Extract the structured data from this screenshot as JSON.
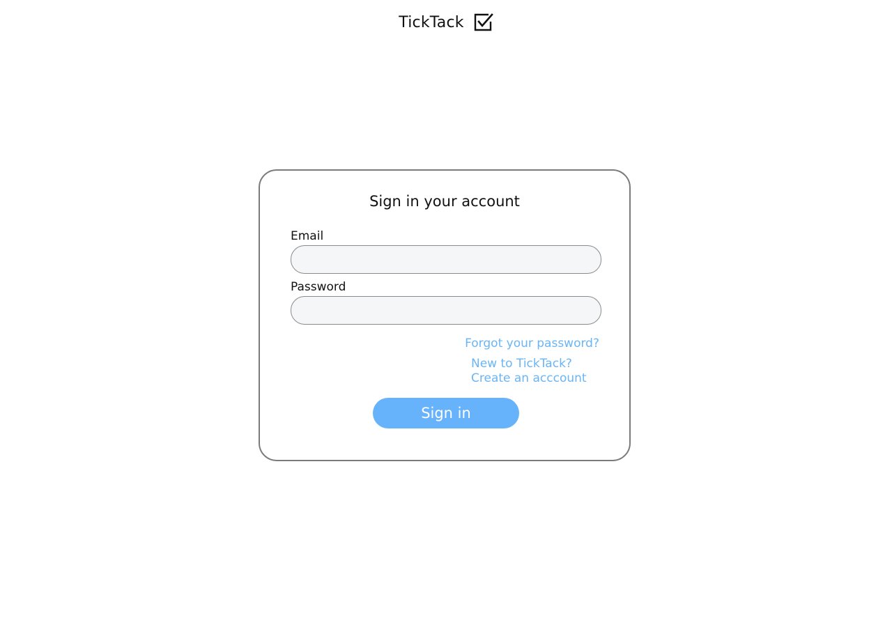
{
  "header": {
    "brand_name": "TickTack",
    "brand_icon": "checkbox-checked-icon"
  },
  "signin_card": {
    "title": "Sign in your account",
    "email_label": "Email",
    "email_value": "",
    "email_placeholder": "",
    "password_label": "Password",
    "password_value": "",
    "password_placeholder": "",
    "forgot_password_link": "Forgot your password?",
    "new_user_text": "New to TickTack?",
    "create_account_link": "Create an acccount",
    "signin_button_label": "Sign in"
  },
  "colors": {
    "accent": "#66b2fb",
    "link": "#6ab5f5",
    "card_border": "#7b7b7b",
    "input_bg": "#f5f6f8"
  }
}
